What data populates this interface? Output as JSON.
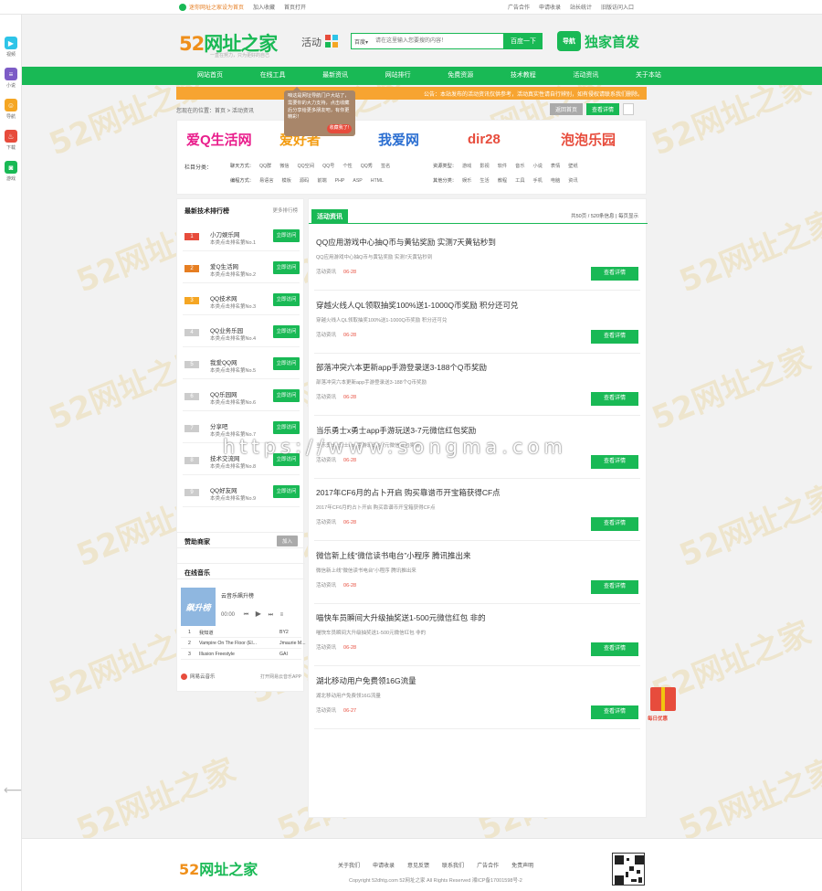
{
  "topbar": {
    "left": [
      "迷你网址之家设为首页",
      "加入收藏",
      "首页打开"
    ],
    "right": [
      "广告合作",
      "申请收录",
      "站长统计",
      "旧版访问入口"
    ]
  },
  "leftdock": [
    {
      "label": "视频",
      "color": "#2ec4e8",
      "glyph": "▶"
    },
    {
      "label": "小说",
      "color": "#7d5cc6",
      "glyph": "≡"
    },
    {
      "label": "导航",
      "color": "#f5a623",
      "glyph": "☺"
    },
    {
      "label": "下载",
      "color": "#e74c3c",
      "glyph": "♨"
    },
    {
      "label": "游戏",
      "color": "#19b955",
      "glyph": "◙"
    }
  ],
  "header": {
    "logo_num": "52",
    "logo_text": "网址之家",
    "logo_sub": "一直在努力，只为更好的自己",
    "activity": "活动",
    "search_select": "百度",
    "search_placeholder": "请在这里输入您要搜的内容！",
    "search_button": "百度一下",
    "right_badge": "导航",
    "right_text": "独家首发"
  },
  "nav": [
    "网站首页",
    "在线工具",
    "最新资讯",
    "网站排行",
    "免费资源",
    "技术教程",
    "活动资讯",
    "关于本站"
  ],
  "notice": "公告：本站发布的活动资讯仅供参考，活动真实性请自行辨别，如有侵权请联系我们删除。",
  "tooltip": {
    "text": "咱这是网址导航门户大站了，需要你的大力支持，点击收藏后分享给更多朋友吧，有你更精彩！",
    "button": "收藏我了!"
  },
  "crumb": "您现在的位置：首页 > 活动资讯",
  "crumb_buttons": [
    "返回首页",
    "查看详情"
  ],
  "sites": [
    {
      "name": "爱Q生活网",
      "color": "#e91e8c"
    },
    {
      "name": "爱好者",
      "color": "#f39c12"
    },
    {
      "name": "我爱网",
      "color": "#2c6fd1"
    },
    {
      "name": "dir28",
      "color": "#e74c3c"
    },
    {
      "name": "泡泡乐园",
      "color": "#e74c3c"
    }
  ],
  "categories": {
    "label": "栏目分类：",
    "row1_label": "聊天方式：",
    "row1": [
      "QQ群",
      "微信",
      "QQ空间",
      "QQ号",
      "个性",
      "QQ秀",
      "签名"
    ],
    "row2_label": "编程方式：",
    "row2": [
      "易语言",
      "模板",
      "源码",
      "前端",
      "PHP",
      "ASP",
      "HTML"
    ],
    "row3_label": "资源类型：",
    "row3": [
      "游戏",
      "影视",
      "软件",
      "音乐",
      "小说",
      "表情",
      "壁纸"
    ],
    "row4_label": "其他分类：",
    "row4": [
      "娱乐",
      "生活",
      "教程",
      "工具",
      "手机",
      "电脑",
      "资讯"
    ]
  },
  "sidebar": {
    "title": "最新技术排行榜",
    "more": "更多排行榜",
    "items": [
      {
        "num": "1",
        "name": "小刀娱乐网",
        "sub": "本类点击排名第No.1",
        "btn": "立即访问",
        "numc": "#e74c3c"
      },
      {
        "num": "2",
        "name": "爱Q生活网",
        "sub": "本类点击排名第No.2",
        "btn": "立即访问",
        "numc": "#e67e22"
      },
      {
        "num": "3",
        "name": "QQ技术网",
        "sub": "本类点击排名第No.3",
        "btn": "立即访问",
        "numc": "#f5a623"
      },
      {
        "num": "4",
        "name": "QQ业务乐园",
        "sub": "本类点击排名第No.4",
        "btn": "立即访问",
        "numc": "#ccc"
      },
      {
        "num": "5",
        "name": "我爱QQ网",
        "sub": "本类点击排名第No.5",
        "btn": "立即访问",
        "numc": "#ccc"
      },
      {
        "num": "6",
        "name": "QQ乐园网",
        "sub": "本类点击排名第No.6",
        "btn": "立即访问",
        "numc": "#ccc"
      },
      {
        "num": "7",
        "name": "分享吧",
        "sub": "本类点击排名第No.7",
        "btn": "立即访问",
        "numc": "#ccc"
      },
      {
        "num": "8",
        "name": "技术交流网",
        "sub": "本类点击排名第No.8",
        "btn": "立即访问",
        "numc": "#ccc"
      },
      {
        "num": "9",
        "name": "QQ好友网",
        "sub": "本类点击排名第No.9",
        "btn": "立即访问",
        "numc": "#ccc"
      }
    ],
    "sponsor_title": "赞助商家",
    "sponsor_btn": "加入",
    "music_title": "在线音乐",
    "player": {
      "cover": "飙升榜",
      "title": "云音乐飙升榜",
      "time": "00:00",
      "tracks": [
        {
          "n": "1",
          "song": "我知道",
          "artist": "BY2"
        },
        {
          "n": "2",
          "song": "Vampire On The Floor (El...",
          "artist": "Jmaurie M..."
        },
        {
          "n": "3",
          "song": "Illusion Freestyle",
          "artist": "GAI"
        }
      ],
      "foot": "网易云音乐",
      "foot_right": "打开网易云音乐APP"
    }
  },
  "main": {
    "tab": "活动资讯",
    "meta": "共50页 / 520条信息 | 每页显示",
    "articles": [
      {
        "title": "QQ应用游戏中心抽Q币与黄钻奖励 实测7天黄钻秒到",
        "desc": "QQ应用游戏中心抽Q币与黄钻奖励 实测7天黄钻秒到",
        "cat": "活动资讯",
        "date": "06-28",
        "btn": "查看详情"
      },
      {
        "title": "穿越火线人QL领取抽奖100%送1-1000Q币奖励 积分还可兑",
        "desc": "穿越火线人QL领取抽奖100%送1-1000Q币奖励 积分还可兑",
        "cat": "活动资讯",
        "date": "06-28",
        "btn": "查看详情"
      },
      {
        "title": "部落冲突六本更新app手游登录送3-188个Q币奖励",
        "desc": "部落冲突六本更新app手游登录送3-188个Q币奖励",
        "cat": "活动资讯",
        "date": "06-28",
        "btn": "查看详情"
      },
      {
        "title": "当乐勇士x勇士app手游玩送3-7元微信红包奖励",
        "desc": "当乐勇士x勇士app手游玩送3-7元微信红包奖励",
        "cat": "活动资讯",
        "date": "06-28",
        "btn": "查看详情"
      },
      {
        "title": "2017年CF6月的占卜开启 购买靠谱币开宝箱获得CF点",
        "desc": "2017年CF6月的占卜开启 购买靠谱币开宝箱获得CF点",
        "cat": "活动资讯",
        "date": "06-28",
        "btn": "查看详情"
      },
      {
        "title": "微信新上线“微信读书电台”小程序 腾讯推出来",
        "desc": "微信新上线“微信读书电台”小程序 腾讯推出来",
        "cat": "活动资讯",
        "date": "06-28",
        "btn": "查看详情"
      },
      {
        "title": "喵快车员瞬间大升级抽奖送1-500元微信红包 非的",
        "desc": "喵快车员瞬间大升级抽奖送1-500元微信红包 非的",
        "cat": "活动资讯",
        "date": "06-28",
        "btn": "查看详情"
      },
      {
        "title": "湖北移动用户免费领16G流量",
        "desc": "湖北移动用户免费领16G流量",
        "cat": "活动资讯",
        "date": "06-27",
        "btn": "查看详情"
      }
    ]
  },
  "gift_label": "每日优惠",
  "url_watermark": "https://www.songma.com",
  "watermark_text": "52网址之家",
  "footer": {
    "logo_num": "52",
    "logo_text": "网址之家",
    "links": [
      "关于我们",
      "申请收录",
      "意见反馈",
      "联系我们",
      "广告合作",
      "免责声明"
    ],
    "copy": "Copyright 52dhtg.com 52网址之家 All Rights Reserved 湘ICP备17001598号-2"
  },
  "colors": {
    "brand": "#19b955",
    "accent": "#ef8f1a",
    "notice": "#f7a431"
  }
}
